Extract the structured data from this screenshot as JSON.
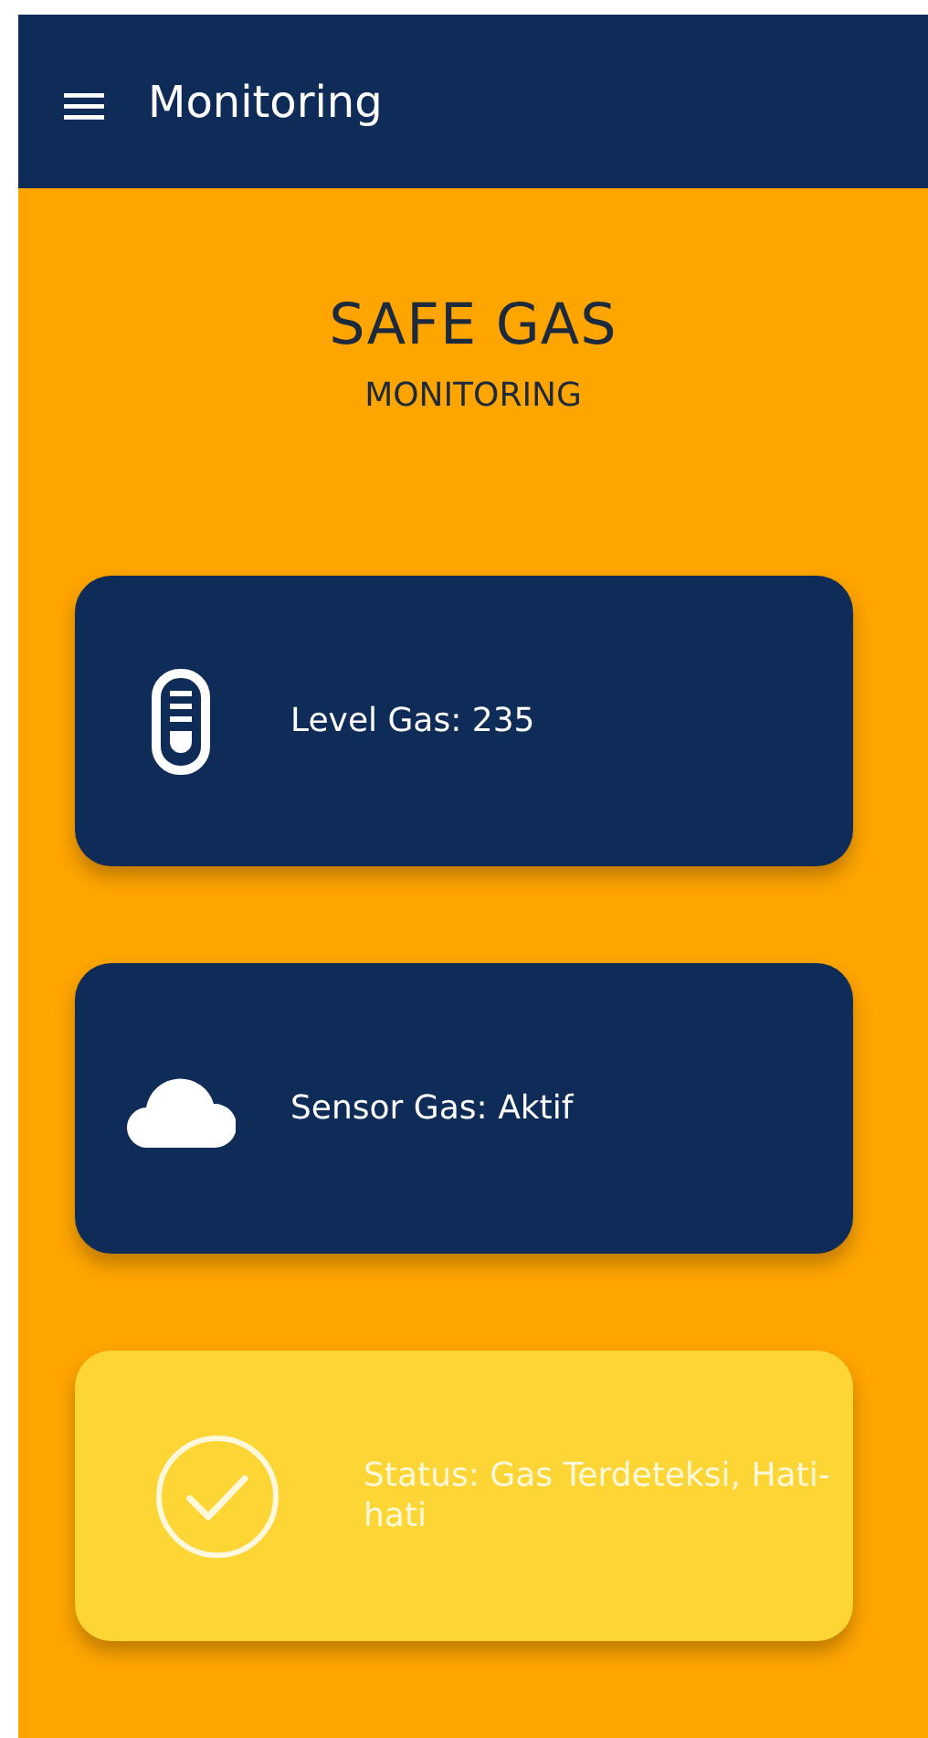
{
  "app_bar": {
    "title": "Monitoring"
  },
  "heading": {
    "title": "SAFE GAS",
    "subtitle": "MONITORING"
  },
  "cards": [
    {
      "kind": "level",
      "text": "Level Gas: 235"
    },
    {
      "kind": "sensor",
      "text": "Sensor Gas: Aktif"
    },
    {
      "kind": "status",
      "text": "Status: Gas Terdeteksi, Hati-hati"
    }
  ]
}
